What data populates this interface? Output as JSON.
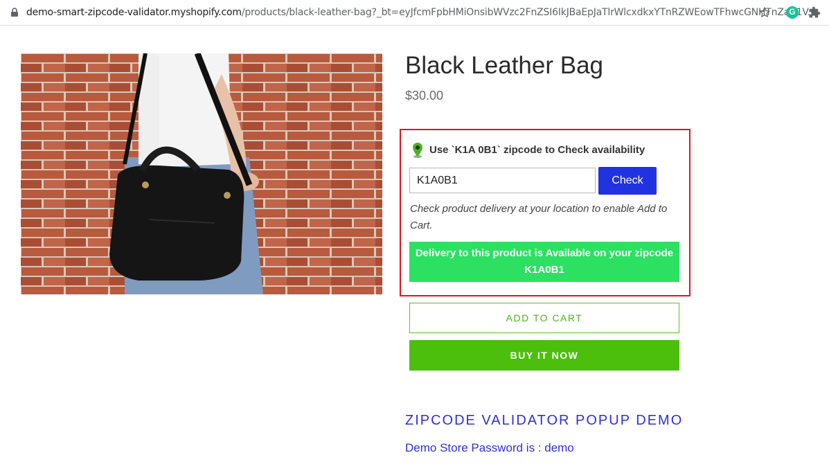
{
  "browser": {
    "url_host": "demo-smart-zipcode-validator.myshopify.com",
    "url_path": "/products/black-leather-bag?_bt=eyJfcmFpbHMiOnsibWVzc2FnZSI6IkJBaEpJaTlrWlcxdkxYTnRZWEowTFhwcGNHTnZaR1V..."
  },
  "product": {
    "title": "Black Leather Bag",
    "price": "$30.00"
  },
  "zip_checker": {
    "heading": "Use `K1A 0B1` zipcode to Check availability",
    "input_value": "K1A0B1",
    "check_label": "Check",
    "note": "Check product delivery at your location to enable Add to Cart.",
    "availability": "Delivery to this product is Available on your zipcode K1A0B1"
  },
  "actions": {
    "add_to_cart": "ADD TO CART",
    "buy_now": "BUY IT NOW"
  },
  "demo": {
    "heading": "ZIPCODE VALIDATOR POPUP DEMO",
    "password": "Demo Store Password is : demo"
  },
  "colors": {
    "check_button": "#2133e0",
    "availability_banner": "#2ce062",
    "buy_now": "#4cbf0d",
    "highlight_border": "#e0141e",
    "demo_link": "#2e2ee0"
  }
}
